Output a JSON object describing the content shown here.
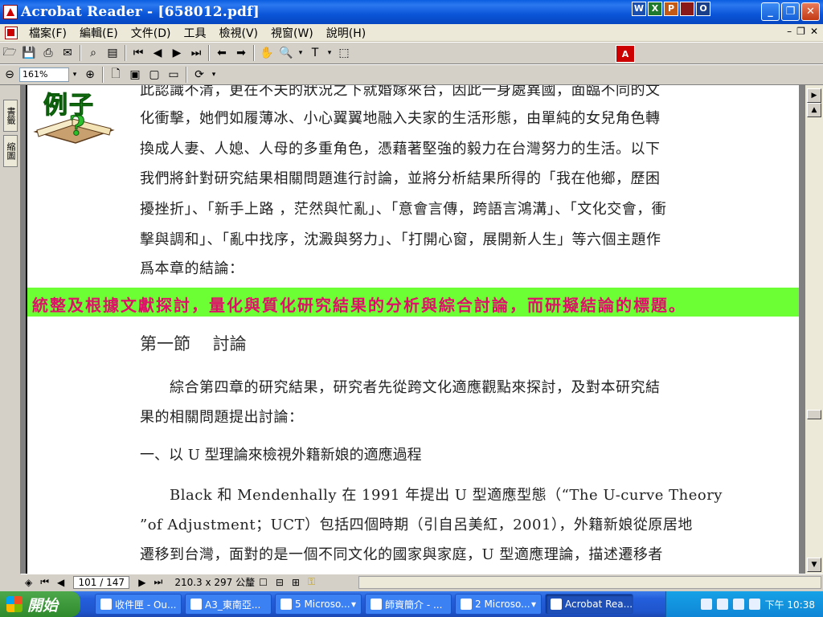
{
  "window": {
    "title": "Acrobat Reader - [658012.pdf]",
    "tray_icons": [
      "W",
      "X",
      "P",
      "",
      "O"
    ]
  },
  "menu": {
    "items": [
      "檔案(F)",
      "編輯(E)",
      "文件(D)",
      "工具",
      "檢視(V)",
      "視窗(W)",
      "說明(H)"
    ]
  },
  "toolbar": {
    "zoom_value": "161%"
  },
  "sidetabs": {
    "bookmarks": "書籤",
    "thumbnails": "縮圖"
  },
  "document": {
    "badge": "例子",
    "para1": [
      "此認識不清，更在不夫的狀況之下就婚嫁來台，因此一身處異國，面臨不同的文",
      "化衝擊，她們如履薄冰、小心翼翼地融入夫家的生活形態，由單純的女兒角色轉",
      "換成人妻、人媳、人母的多重角色，憑藉著堅強的毅力在台灣努力的生活。以下",
      "我們將針對研究結果相關問題進行討論，並將分析結果所得的「我在他鄉，歷困",
      "擾挫折」、「新手上路 ，茫然與忙亂」、「意會言傳，跨語言鴻溝」、「文化交會，衝",
      "擊與調和」、「亂中找序，沈澱與努力」、「打開心窗，展開新人生」等六個主題作",
      "爲本章的結論："
    ],
    "highlight": "統整及根據文獻探討，量化與質化研究結果的分析與綜合討論，而研擬結論的標題。",
    "section_heading": "第一節　 討論",
    "para2": [
      "　　綜合第四章的研究結果，研究者先從跨文化適應觀點來探討，及對本研究結",
      "果的相關問題提出討論："
    ],
    "sub_heading": "一、以 U 型理論來檢視外籍新娘的適應過程",
    "para3": [
      "　　Black 和 Mendenhally 在 1991 年提出 U 型適應型態（“The U-curve Theory",
      "”of Adjustment；UCT）包括四個時期（引自呂美紅，2001），外籍新娘從原居地",
      "遷移到台灣，面對的是一個不同文化的國家與家庭，U 型適應理論，描述遷移者"
    ]
  },
  "status": {
    "page": "101 / 147",
    "dimensions": "210.3 x 297 公釐"
  },
  "taskbar": {
    "start": "開始",
    "tasks": [
      "收件匣 - Ou...",
      "A3_東南亞...",
      "5 Microso...",
      "師資簡介 - ...",
      "2 Microso...",
      "Acrobat Rea..."
    ],
    "clock": "下午 10:38"
  }
}
